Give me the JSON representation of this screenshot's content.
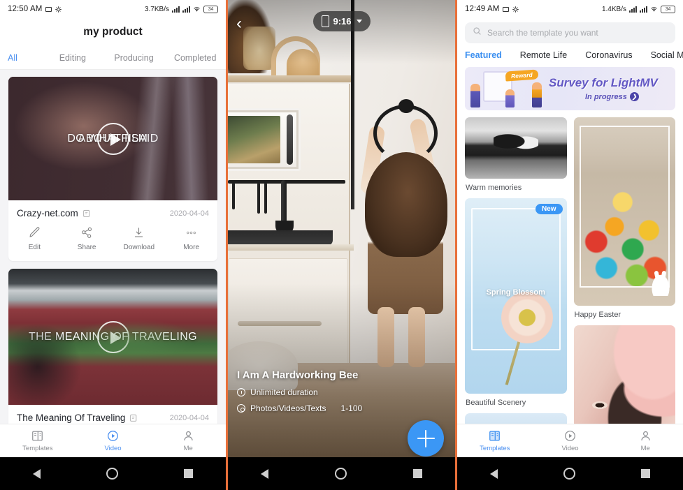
{
  "panel1": {
    "status": {
      "time": "12:50 AM",
      "netspeed": "3.7KB/s",
      "battery": "34"
    },
    "title": "my product",
    "tabs": [
      {
        "label": "All",
        "active": true
      },
      {
        "label": "Editing",
        "active": false
      },
      {
        "label": "Producing",
        "active": false
      },
      {
        "label": "Completed",
        "active": false
      }
    ],
    "videos": [
      {
        "overlay_text": "ABOUT FILM",
        "overlay_text2": "DO WHAT I SAID",
        "name": "Crazy-net.com",
        "date": "2020-04-04",
        "actions": [
          {
            "label": "Edit",
            "icon": "pencil-icon"
          },
          {
            "label": "Share",
            "icon": "share-icon"
          },
          {
            "label": "Download",
            "icon": "download-icon"
          },
          {
            "label": "More",
            "icon": "more-icon"
          }
        ]
      },
      {
        "overlay_text": "THE MEANING OF TRAVELING",
        "overlay_text2": "THE MEANING OF TRAVELING",
        "name": "The Meaning Of Traveling",
        "date": "2020-04-04",
        "actions": []
      }
    ],
    "tabbar": [
      {
        "label": "Templates",
        "icon": "templates-icon",
        "active": false
      },
      {
        "label": "Video",
        "icon": "video-icon",
        "active": true
      },
      {
        "label": "Me",
        "icon": "person-icon",
        "active": false
      }
    ]
  },
  "panel2": {
    "back_icon": "chevron-left-icon",
    "ratio_pill": {
      "label": "9:16",
      "icon": "phone-portrait-icon",
      "caret": "chevron-down-icon"
    },
    "template": {
      "title": "I Am A Hardworking Bee",
      "duration_label": "Unlimited duration",
      "media_label": "Photos/Videos/Texts",
      "media_value": "1-100"
    },
    "fab": {
      "icon": "plus-icon",
      "color": "#3b97f5"
    }
  },
  "panel3": {
    "status": {
      "time": "12:49 AM",
      "netspeed": "1.4KB/s",
      "battery": "34"
    },
    "search": {
      "placeholder": "Search the template you want",
      "icon": "search-icon"
    },
    "tabs": [
      {
        "label": "Featured",
        "active": true
      },
      {
        "label": "Remote Life",
        "active": false
      },
      {
        "label": "Coronavirus",
        "active": false
      },
      {
        "label": "Social M",
        "active": false
      }
    ],
    "banner": {
      "title": "Survey for LightMV",
      "subtitle": "In progress",
      "badge": "Reward",
      "arrow_icon": "chevron-right-icon"
    },
    "templates_left": [
      {
        "caption": "Warm memories",
        "badge": "",
        "overlay": ""
      },
      {
        "caption": "Beautiful Scenery",
        "badge": "New",
        "overlay": "Spring Blossom"
      },
      {
        "caption": "",
        "badge": "",
        "overlay": ""
      }
    ],
    "templates_right": [
      {
        "caption": "Happy Easter",
        "badge": "",
        "overlay": ""
      },
      {
        "caption": "",
        "badge": "",
        "overlay": ""
      }
    ],
    "tabbar": [
      {
        "label": "Templates",
        "icon": "templates-icon",
        "active": true
      },
      {
        "label": "Video",
        "icon": "video-icon",
        "active": false
      },
      {
        "label": "Me",
        "icon": "person-icon",
        "active": false
      }
    ]
  },
  "navbar": {
    "back": "back-triangle",
    "home": "home-circle",
    "recents": "recents-square"
  }
}
